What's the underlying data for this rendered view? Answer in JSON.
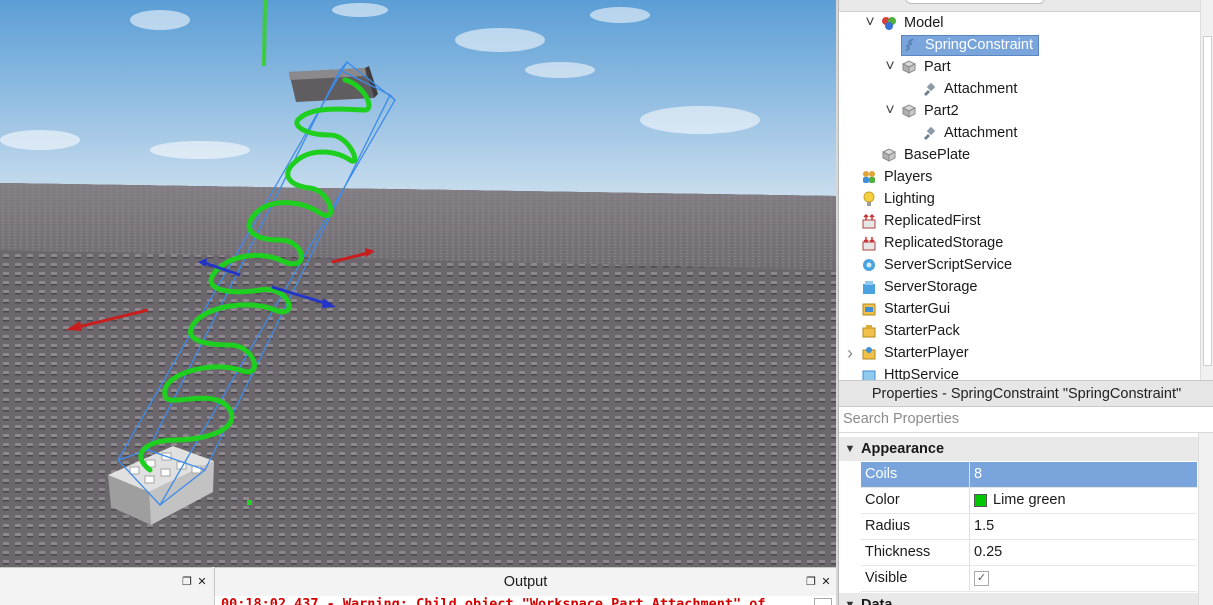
{
  "explorer": {
    "items": [
      {
        "label": "Model",
        "indent": 1,
        "arrow": "expanded",
        "icon": "model-icon"
      },
      {
        "label": "SpringConstraint",
        "indent": 2,
        "arrow": "none",
        "icon": "spring-constraint-icon",
        "selected": true
      },
      {
        "label": "Part",
        "indent": 2,
        "arrow": "expanded",
        "icon": "part-icon"
      },
      {
        "label": "Attachment",
        "indent": 3,
        "arrow": "none",
        "icon": "attachment-icon"
      },
      {
        "label": "Part2",
        "indent": 2,
        "arrow": "expanded",
        "icon": "part-icon"
      },
      {
        "label": "Attachment",
        "indent": 3,
        "arrow": "none",
        "icon": "attachment-icon"
      },
      {
        "label": "BasePlate",
        "indent": 1,
        "arrow": "none",
        "icon": "part-icon"
      },
      {
        "label": "Players",
        "indent": 0,
        "arrow": "none",
        "icon": "players-icon"
      },
      {
        "label": "Lighting",
        "indent": 0,
        "arrow": "none",
        "icon": "lighting-icon"
      },
      {
        "label": "ReplicatedFirst",
        "indent": 0,
        "arrow": "none",
        "icon": "replicated-first-icon"
      },
      {
        "label": "ReplicatedStorage",
        "indent": 0,
        "arrow": "none",
        "icon": "replicated-storage-icon"
      },
      {
        "label": "ServerScriptService",
        "indent": 0,
        "arrow": "none",
        "icon": "server-script-service-icon"
      },
      {
        "label": "ServerStorage",
        "indent": 0,
        "arrow": "none",
        "icon": "server-storage-icon"
      },
      {
        "label": "StarterGui",
        "indent": 0,
        "arrow": "none",
        "icon": "starter-gui-icon"
      },
      {
        "label": "StarterPack",
        "indent": 0,
        "arrow": "none",
        "icon": "starter-pack-icon"
      },
      {
        "label": "StarterPlayer",
        "indent": 0,
        "arrow": "collapsed",
        "icon": "starter-player-icon"
      },
      {
        "label": "HttpService",
        "indent": 0,
        "arrow": "none",
        "icon": "http-service-icon"
      }
    ]
  },
  "properties": {
    "title": "Properties - SpringConstraint \"SpringConstraint\"",
    "search_placeholder": "Search Properties",
    "category_appearance": "Appearance",
    "category_data": "Data",
    "rows": [
      {
        "name": "Coils",
        "value": "8",
        "selected": true
      },
      {
        "name": "Color",
        "value": "Lime green",
        "swatch": "#00c800"
      },
      {
        "name": "Radius",
        "value": "1.5"
      },
      {
        "name": "Thickness",
        "value": "0.25"
      },
      {
        "name": "Visible",
        "value": "",
        "checkbox": true
      }
    ]
  },
  "output": {
    "title": "Output",
    "log_line": "00:18:02.437 - Warning: Child object \"Workspace.Part.Attachment\" of"
  },
  "colors": {
    "selection": "#7aa5dc",
    "spring": "#22d422",
    "sky_top": "#5b9ed6",
    "sky_bottom": "#c7dcef",
    "baseplate": "#6f6a70"
  }
}
